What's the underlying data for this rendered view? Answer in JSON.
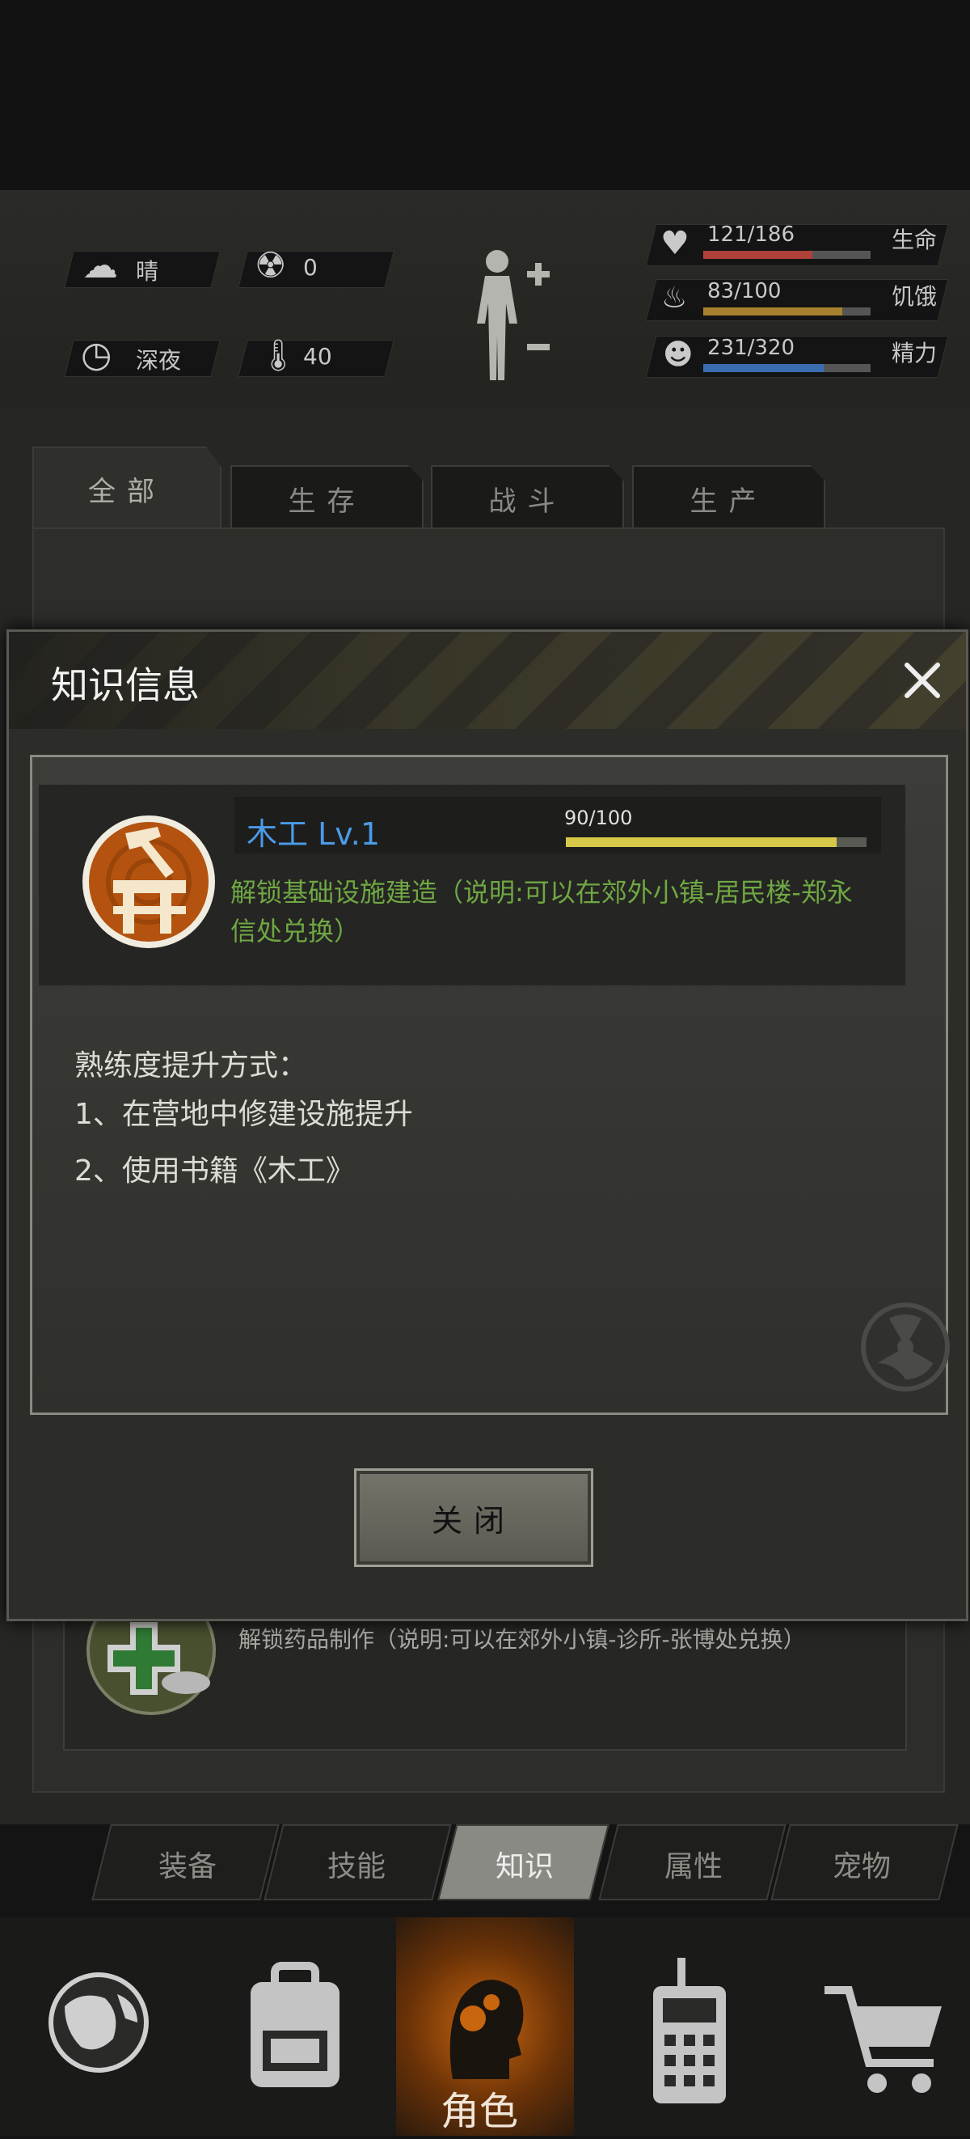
{
  "status": {
    "weather": "晴",
    "radiation": "0",
    "time_of_day": "深夜",
    "temperature": "40",
    "health": {
      "value": "121/186",
      "label": "生命",
      "fraction": 0.65,
      "color": "#b0413a"
    },
    "hunger": {
      "value": "83/100",
      "label": "饥饿",
      "fraction": 0.83,
      "color": "#a8812e"
    },
    "energy": {
      "value": "231/320",
      "label": "精力",
      "fraction": 0.72,
      "color": "#3a6db0"
    }
  },
  "category_tabs": [
    "全部",
    "生存",
    "战斗",
    "生产"
  ],
  "modal": {
    "title": "知识信息",
    "skill_name": "木工 Lv.1",
    "progress_text": "90/100",
    "progress_fraction": 0.9,
    "skill_desc": "解锁基础设施建造（说明:可以在郊外小镇-居民楼-郑永信处兑换）",
    "skill_desc_line1": "解锁基础设施建造（说明:可以在郊外小镇-居民楼-郑永",
    "skill_desc_line2": "信处兑换）",
    "methods_title": "熟练度提升方式：",
    "method_1": "1、在营地中修建设施提升",
    "method_2": "2、使用书籍《木工》",
    "close_label": "关闭"
  },
  "list_item": {
    "desc": "解锁药品制作（说明:可以在郊外小镇-诊所-张博处兑换）"
  },
  "sub_tabs": [
    "装备",
    "技能",
    "知识",
    "属性",
    "宠物"
  ],
  "bottom_nav": {
    "active_label": "角色"
  },
  "icons": [
    "cloud-icon",
    "radiation-icon",
    "clock-icon",
    "thermometer-icon",
    "body-icon",
    "heart-icon",
    "stomach-icon",
    "head-icon",
    "globe-icon",
    "backpack-icon",
    "walkie-talkie-icon",
    "cart-icon",
    "close-icon",
    "hammer-icon",
    "medicine-icon"
  ],
  "colors": {
    "accent_blue": "#4a9be8",
    "desc_green": "#6fa843",
    "progress_yellow": "#d8c84a"
  }
}
